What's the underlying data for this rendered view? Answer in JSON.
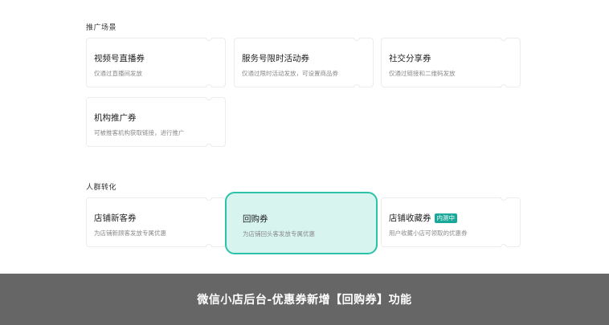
{
  "sections": [
    {
      "title": "推广场景",
      "cards": [
        {
          "name": "视频号直播券",
          "desc": "仅通过直播间发放"
        },
        {
          "name": "服务号限时活动券",
          "desc": "仅通过限时活动发放，可设置商品券"
        },
        {
          "name": "社交分享券",
          "desc": "仅通过链接和二维码发放"
        },
        {
          "name": "机构推广券",
          "desc": "可被推客机构获取链接，进行推广"
        }
      ]
    },
    {
      "title": "人群转化",
      "cards": [
        {
          "name": "店铺新客券",
          "desc": "为店铺新顾客发放专属优惠"
        },
        {
          "name": "回购券",
          "desc": "为店铺回头客发放专属优惠"
        },
        {
          "name": "店铺收藏券",
          "desc": "用户收藏小店可领取的优惠券",
          "badge": "内测中"
        }
      ]
    }
  ],
  "banner": {
    "text": "微信小店后台-优惠券新增【回购券】功能"
  },
  "colors": {
    "highlight_bg": "#d7f4ee",
    "highlight_border": "#2cc1a9",
    "badge_bg": "#1aa89a",
    "banner_bg": "#666666"
  }
}
